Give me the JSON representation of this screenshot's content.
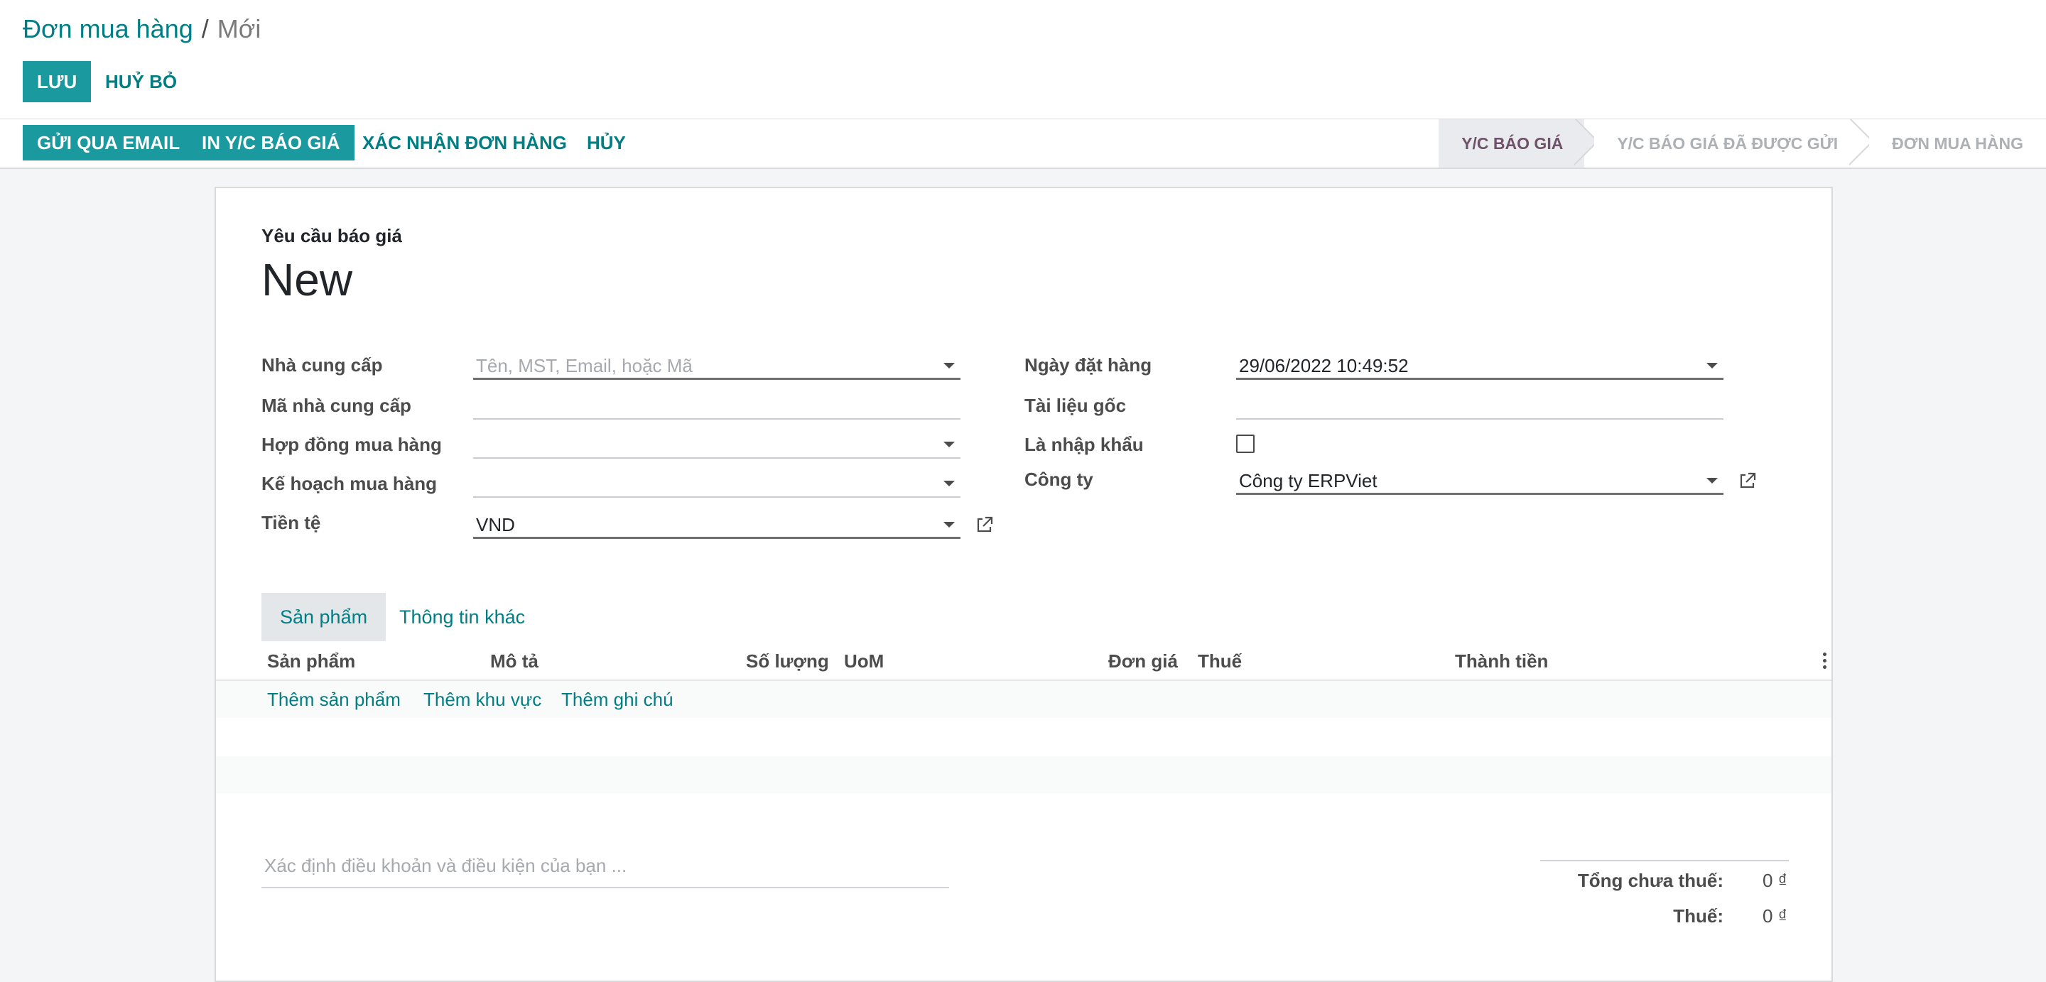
{
  "breadcrumb": {
    "parent": "Đơn mua hàng",
    "separator": "/",
    "current": "Mới"
  },
  "toolbar": {
    "save_label": "LƯU",
    "discard_label": "HUỶ BỎ"
  },
  "statusbar": {
    "actions": {
      "send_email": "GỬI QUA EMAIL",
      "print_rfq": "IN Y/C BÁO GIÁ",
      "confirm_order": "XÁC NHẬN ĐƠN HÀNG",
      "cancel": "HỦY"
    },
    "stages": {
      "rfq": "Y/C BÁO GIÁ",
      "rfq_sent": "Y/C BÁO GIÁ ĐÃ ĐƯỢC GỬI",
      "purchase_order": "ĐƠN MUA HÀNG"
    }
  },
  "sheet": {
    "label": "Yêu cầu báo giá",
    "title": "New",
    "fields": {
      "vendor": {
        "label": "Nhà cung cấp",
        "value": "",
        "placeholder": "Tên, MST, Email, hoặc Mã"
      },
      "vendor_ref": {
        "label": "Mã nhà cung cấp",
        "value": ""
      },
      "purchase_contract": {
        "label": "Hợp đồng mua hàng",
        "value": ""
      },
      "purchase_plan": {
        "label": "Kế hoạch mua hàng",
        "value": ""
      },
      "currency": {
        "label": "Tiền tệ",
        "value": "VND"
      },
      "order_date": {
        "label": "Ngày đặt hàng",
        "value": "29/06/2022 10:49:52"
      },
      "source_document": {
        "label": "Tài liệu gốc",
        "value": ""
      },
      "is_import": {
        "label": "Là nhập khẩu",
        "checked": false
      },
      "company": {
        "label": "Công ty",
        "value": "Công ty ERPViet"
      }
    },
    "tabs": {
      "products": "Sản phẩm",
      "other_info": "Thông tin khác"
    },
    "table": {
      "columns": {
        "product": "Sản phẩm",
        "description": "Mô tả",
        "quantity": "Số lượng",
        "uom": "UoM",
        "unit_price": "Đơn giá",
        "taxes": "Thuế",
        "subtotal": "Thành tiền"
      },
      "add_links": {
        "add_product": "Thêm sản phẩm",
        "add_section": "Thêm khu vực",
        "add_note": "Thêm ghi chú"
      }
    },
    "terms_placeholder": "Xác định điều khoản và điều kiện của bạn ...",
    "totals": {
      "untaxed_label": "Tổng chưa thuế:",
      "untaxed_value": "0 ₫",
      "tax_label": "Thuế:",
      "tax_value": "0 ₫"
    }
  },
  "colors": {
    "primary": "#1a9a9e",
    "link": "#017e84",
    "active_stage": "#70516a"
  }
}
